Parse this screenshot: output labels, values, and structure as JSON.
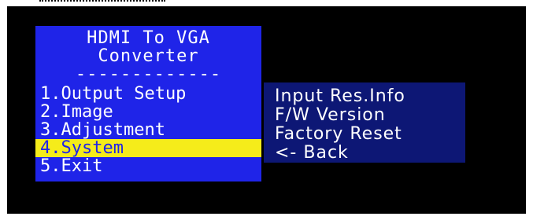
{
  "title_lines": [
    "HDMI To VGA",
    "Converter"
  ],
  "divider": "-------------",
  "main_menu": {
    "items": [
      {
        "label": "1.Output Setup"
      },
      {
        "label": "2.Image"
      },
      {
        "label": "3.Adjustment"
      },
      {
        "label": "4.System",
        "selected": true
      },
      {
        "label": "5.Exit"
      }
    ]
  },
  "sub_menu": {
    "items": [
      {
        "label": "Input Res.Info"
      },
      {
        "label": "F/W Version"
      },
      {
        "label": "Factory Reset"
      },
      {
        "label": "<- Back"
      }
    ]
  },
  "colors": {
    "menu_background": "#1f24e8",
    "submenu_background": "#0d1775",
    "highlight": "#f5ec1a",
    "text": "#ffffff",
    "screen": "#000000"
  }
}
